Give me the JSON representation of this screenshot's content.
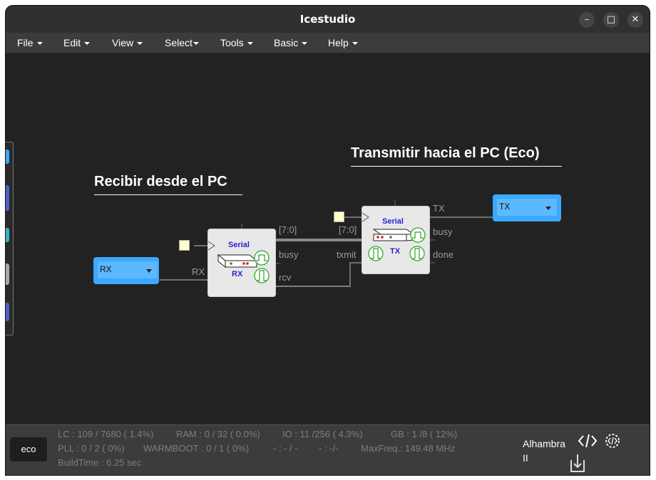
{
  "app": {
    "title": "Icestudio"
  },
  "window_buttons": {
    "minimize": "–",
    "maximize": "□",
    "close": "✕"
  },
  "menu": [
    {
      "label": "File"
    },
    {
      "label": "Edit"
    },
    {
      "label": "View"
    },
    {
      "label": "Select"
    },
    {
      "label": "Tools"
    },
    {
      "label": "Basic"
    },
    {
      "label": "Help"
    }
  ],
  "canvas": {
    "comments": {
      "receive": "Recibir desde el PC",
      "transmit": "Transmitir hacia el PC (Eco)"
    },
    "input_port": {
      "label": "RX",
      "wire_label": "RX"
    },
    "output_port": {
      "label": "TX",
      "wire_label": "TX"
    },
    "rx_block": {
      "title": "Serial",
      "subtitle": "RX",
      "out_data": "[7:0]",
      "out_busy": "busy",
      "out_rcv": "rcv"
    },
    "tx_block": {
      "title": "Serial",
      "subtitle": "TX",
      "in_data": "[7:0]",
      "in_txmit": "txmit",
      "out_tx": "TX",
      "out_busy": "busy",
      "out_done": "done"
    }
  },
  "colors": {
    "port_blue": "#3da8ff",
    "serial_text": "#2a1fd0",
    "canvas_bg": "#222222"
  },
  "status": {
    "eco_button": "eco",
    "lc": "LC : 109 / 7680 ( 1.4%)",
    "ram": "RAM : 0 / 32 ( 0.0%)",
    "io": "IO :  11 /256  ( 4.3%)",
    "gb": "GB :  1 /8  ( 12%)",
    "pll": "PLL : 0 / 2 ( 0%)",
    "warmboot": "WARMBOOT : 0 / 1 ( 0%)",
    "misc1": "- : - / -",
    "misc2": "- :  -/-",
    "maxfreq": "MaxFreq.:   149.48 MHz",
    "buildtime": "BuildTime :    6.25 sec",
    "board": "Alhambra II"
  }
}
